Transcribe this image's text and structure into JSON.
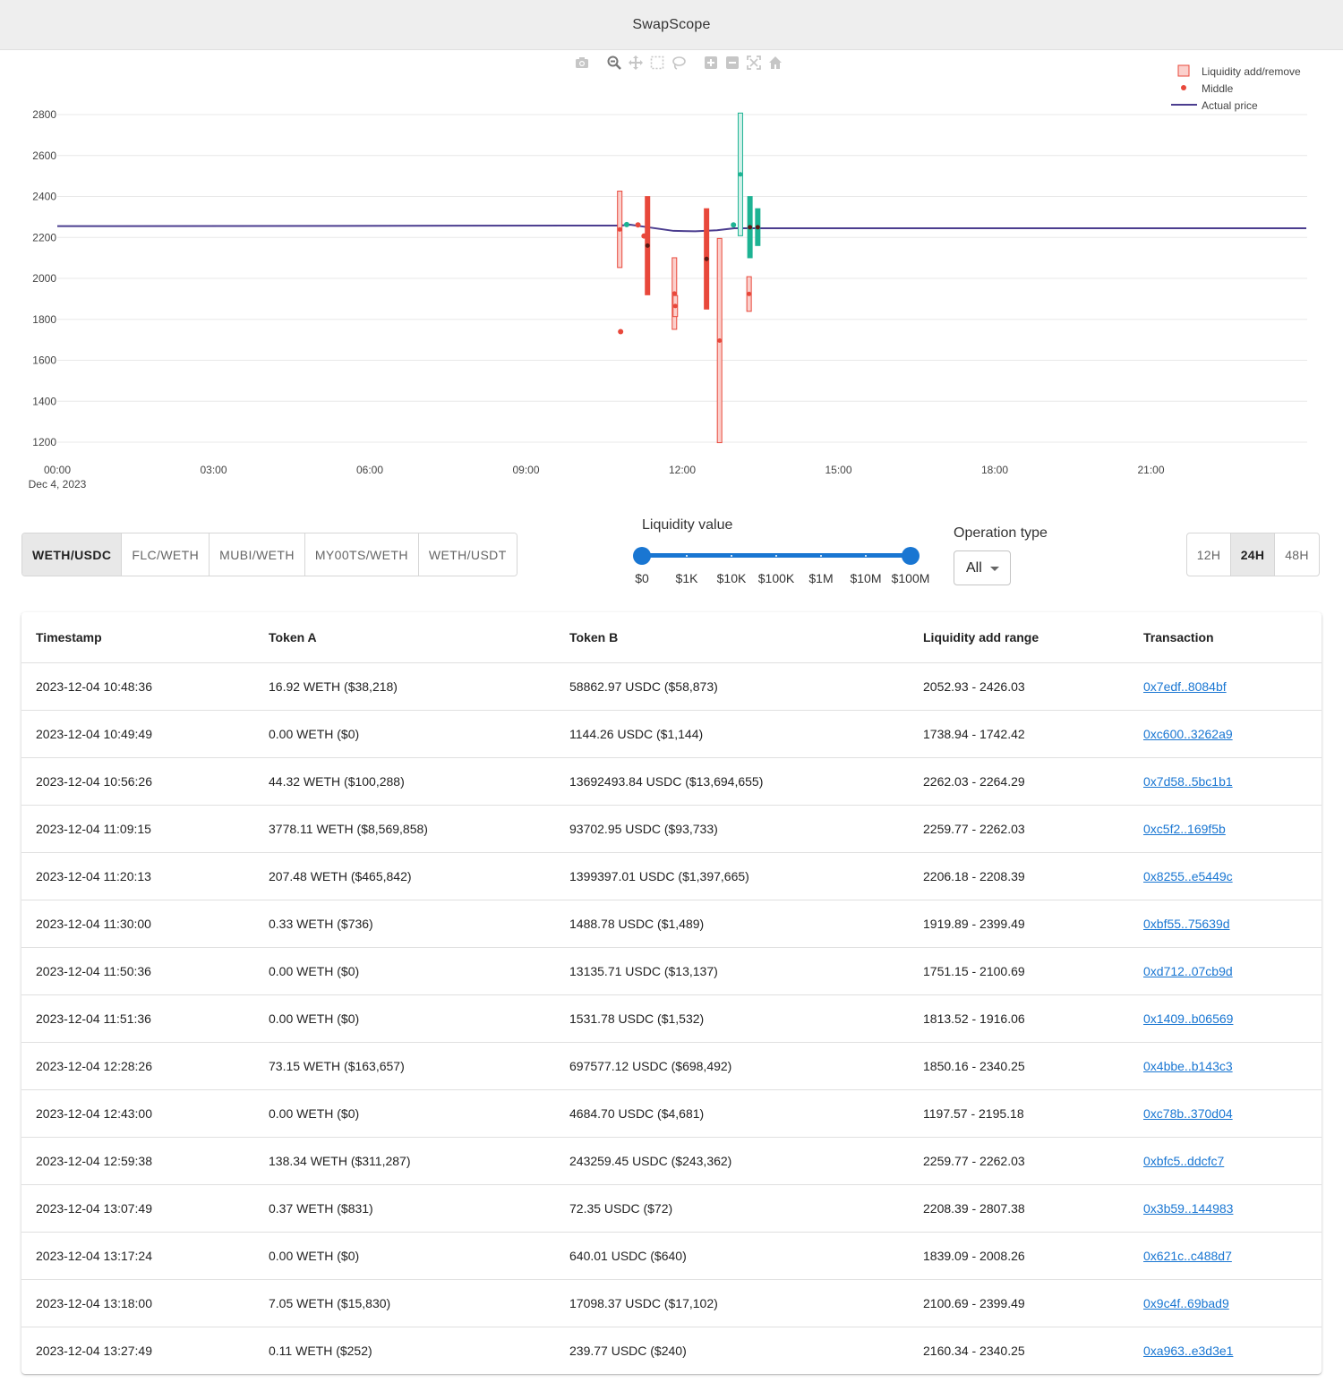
{
  "app": {
    "title": "SwapScope"
  },
  "modebar": {
    "icons": [
      "camera-icon",
      "zoom-icon",
      "pan-icon",
      "box-select-icon",
      "lasso-select-icon",
      "zoom-in-icon",
      "zoom-out-icon",
      "autoscale-icon",
      "reset-axes-icon"
    ]
  },
  "chart_data": {
    "type": "candlestick-range",
    "x_ticks": [
      "00:00",
      "03:00",
      "06:00",
      "09:00",
      "12:00",
      "15:00",
      "18:00",
      "21:00"
    ],
    "x_date_label": "Dec 4, 2023",
    "y_ticks": [
      1200,
      1400,
      1600,
      1800,
      2000,
      2200,
      2400,
      2600,
      2800
    ],
    "ylim": [
      1200,
      2820
    ],
    "xlim_hours": [
      0,
      24
    ],
    "legend": [
      {
        "name": "Liquidity add/remove",
        "symbol": "box"
      },
      {
        "name": "Middle",
        "symbol": "dot"
      },
      {
        "name": "Actual price",
        "symbol": "line"
      }
    ],
    "legend_position": "top-right",
    "colors": {
      "remove_fill": "#fbd0cc",
      "remove_line": "#e8483b",
      "add_fill": "#d3f1ea",
      "add_line": "#1db393",
      "price_line": "#4b3d8f",
      "grid": "#e8e8e8"
    },
    "actual_price": [
      {
        "t": "00:00",
        "p": 2255
      },
      {
        "t": "10:48",
        "p": 2258
      },
      {
        "t": "11:00",
        "p": 2262
      },
      {
        "t": "11:20",
        "p": 2250
      },
      {
        "t": "11:50",
        "p": 2232
      },
      {
        "t": "12:15",
        "p": 2230
      },
      {
        "t": "12:40",
        "p": 2235
      },
      {
        "t": "13:00",
        "p": 2245
      },
      {
        "t": "13:30",
        "p": 2245
      },
      {
        "t": "23:59",
        "p": 2245
      }
    ],
    "ranges": [
      {
        "t": "10:48",
        "low": 2052.93,
        "high": 2426.03,
        "mid": 2239,
        "style": "hollow-red"
      },
      {
        "t": "11:20",
        "low": 1919.89,
        "high": 2399.49,
        "mid": 2160,
        "style": "solid-red"
      },
      {
        "t": "11:51",
        "low": 1751.15,
        "high": 2100.69,
        "mid": 1926,
        "style": "hollow-red"
      },
      {
        "t": "11:52",
        "low": 1813.52,
        "high": 1916.06,
        "mid": 1865,
        "style": "hollow-red"
      },
      {
        "t": "12:28",
        "low": 1850.16,
        "high": 2340.25,
        "mid": 2095,
        "style": "solid-red"
      },
      {
        "t": "12:43",
        "low": 1197.57,
        "high": 2195.18,
        "mid": 1696,
        "style": "hollow-red"
      },
      {
        "t": "13:07",
        "low": 2208.39,
        "high": 2807.38,
        "mid": 2508,
        "style": "hollow-green"
      },
      {
        "t": "13:17",
        "low": 1839.09,
        "high": 2008.26,
        "mid": 1924,
        "style": "hollow-red"
      },
      {
        "t": "13:18",
        "low": 2100.69,
        "high": 2399.49,
        "mid": 2250,
        "style": "solid-green"
      },
      {
        "t": "13:27",
        "low": 2160.34,
        "high": 2340.25,
        "mid": 2250,
        "style": "solid-green"
      }
    ],
    "points": [
      {
        "t": "10:49",
        "p": 1740,
        "color": "red"
      },
      {
        "t": "10:56",
        "p": 2263,
        "color": "green"
      },
      {
        "t": "11:09",
        "p": 2261,
        "color": "red"
      },
      {
        "t": "11:16",
        "p": 2207,
        "color": "red"
      },
      {
        "t": "12:59",
        "p": 2261,
        "color": "green"
      }
    ]
  },
  "filters": {
    "pairs": [
      "WETH/USDC",
      "FLC/WETH",
      "MUBI/WETH",
      "MY00TS/WETH",
      "WETH/USDT"
    ],
    "active_pair": 0,
    "liquidity": {
      "label": "Liquidity value",
      "marks": [
        "$0",
        "$1K",
        "$10K",
        "$100K",
        "$1M",
        "$10M",
        "$100M"
      ],
      "min_value": "$0",
      "max_value": "$100M"
    },
    "operation": {
      "label": "Operation type",
      "value": "All"
    },
    "time_ranges": [
      "12H",
      "24H",
      "48H"
    ],
    "active_range": 1
  },
  "table": {
    "headers": [
      "Timestamp",
      "Token A",
      "Token B",
      "Liquidity add range",
      "Transaction"
    ],
    "rows": [
      [
        "2023-12-04 10:48:36",
        "16.92 WETH ($38,218)",
        "58862.97 USDC ($58,873)",
        "2052.93 - 2426.03",
        "0x7edf..8084bf"
      ],
      [
        "2023-12-04 10:49:49",
        "0.00 WETH ($0)",
        "1144.26 USDC ($1,144)",
        "1738.94 - 1742.42",
        "0xc600..3262a9"
      ],
      [
        "2023-12-04 10:56:26",
        "44.32 WETH ($100,288)",
        "13692493.84 USDC ($13,694,655)",
        "2262.03 - 2264.29",
        "0x7d58..5bc1b1"
      ],
      [
        "2023-12-04 11:09:15",
        "3778.11 WETH ($8,569,858)",
        "93702.95 USDC ($93,733)",
        "2259.77 - 2262.03",
        "0xc5f2..169f5b"
      ],
      [
        "2023-12-04 11:20:13",
        "207.48 WETH ($465,842)",
        "1399397.01 USDC ($1,397,665)",
        "2206.18 - 2208.39",
        "0x8255..e5449c"
      ],
      [
        "2023-12-04 11:30:00",
        "0.33 WETH ($736)",
        "1488.78 USDC ($1,489)",
        "1919.89 - 2399.49",
        "0xbf55..75639d"
      ],
      [
        "2023-12-04 11:50:36",
        "0.00 WETH ($0)",
        "13135.71 USDC ($13,137)",
        "1751.15 - 2100.69",
        "0xd712..07cb9d"
      ],
      [
        "2023-12-04 11:51:36",
        "0.00 WETH ($0)",
        "1531.78 USDC ($1,532)",
        "1813.52 - 1916.06",
        "0x1409..b06569"
      ],
      [
        "2023-12-04 12:28:26",
        "73.15 WETH ($163,657)",
        "697577.12 USDC ($698,492)",
        "1850.16 - 2340.25",
        "0x4bbe..b143c3"
      ],
      [
        "2023-12-04 12:43:00",
        "0.00 WETH ($0)",
        "4684.70 USDC ($4,681)",
        "1197.57 - 2195.18",
        "0xc78b..370d04"
      ],
      [
        "2023-12-04 12:59:38",
        "138.34 WETH ($311,287)",
        "243259.45 USDC ($243,362)",
        "2259.77 - 2262.03",
        "0xbfc5..ddcfc7"
      ],
      [
        "2023-12-04 13:07:49",
        "0.37 WETH ($831)",
        "72.35 USDC ($72)",
        "2208.39 - 2807.38",
        "0x3b59..144983"
      ],
      [
        "2023-12-04 13:17:24",
        "0.00 WETH ($0)",
        "640.01 USDC ($640)",
        "1839.09 - 2008.26",
        "0x621c..c488d7"
      ],
      [
        "2023-12-04 13:18:00",
        "7.05 WETH ($15,830)",
        "17098.37 USDC ($17,102)",
        "2100.69 - 2399.49",
        "0x9c4f..69bad9"
      ],
      [
        "2023-12-04 13:27:49",
        "0.11 WETH ($252)",
        "239.77 USDC ($240)",
        "2160.34 - 2340.25",
        "0xa963..e3d3e1"
      ]
    ]
  }
}
